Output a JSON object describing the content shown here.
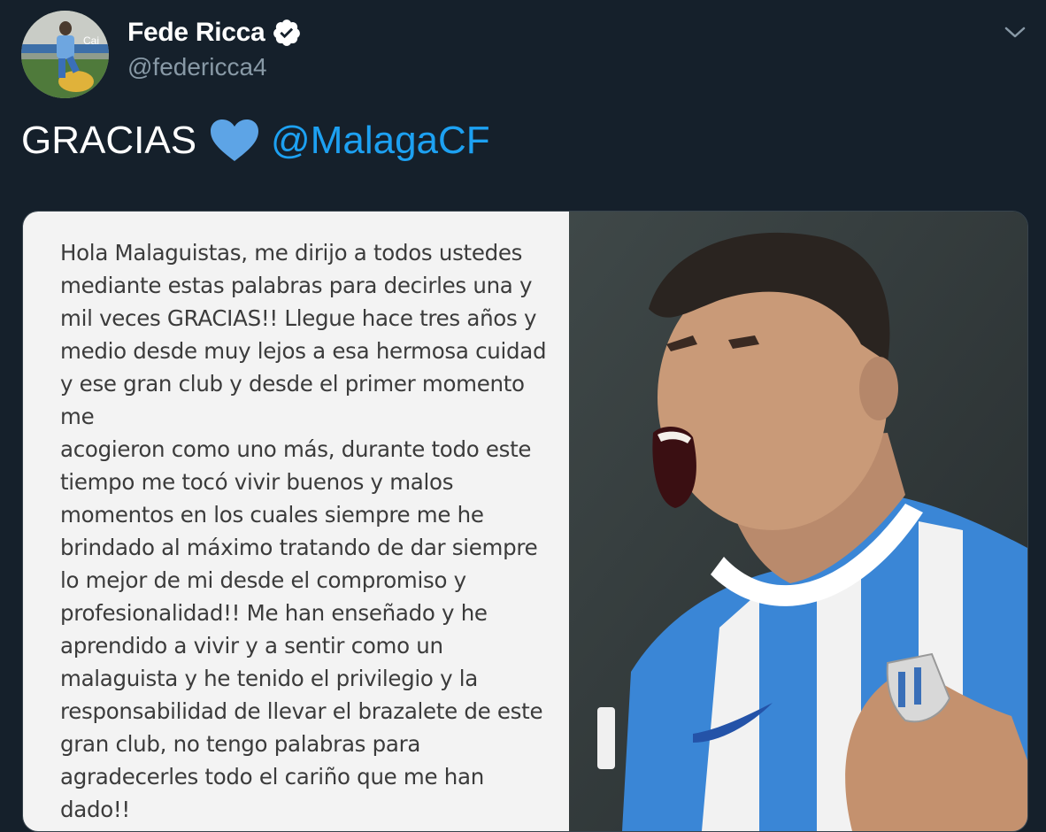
{
  "tweet": {
    "display_name": "Fede Ricca",
    "handle": "@federicca4",
    "text_prefix": "GRACIAS",
    "mention": "@MalagaCF",
    "icons": {
      "verified": "verified-badge-icon",
      "heart": "blue-heart-icon",
      "menu": "chevron-down-icon"
    },
    "colors": {
      "background": "#15202b",
      "mention": "#1da1f2",
      "heart": "#5da4e6",
      "handle": "#8899a6"
    }
  },
  "media": {
    "letter_text": "Hola Malaguistas, me dirijo a todos ustedes\nmediante estas palabras para decirles una y\nmil veces GRACIAS!! Llegue hace tres años y\nmedio desde muy lejos a esa hermosa cuidad\ny ese gran club y desde el primer momento me\nacogieron como uno más, durante todo este\ntiempo me tocó vivir buenos y malos\nmomentos en los cuales siempre me he\nbrindado al máximo tratando de dar siempre\nlo mejor de mi desde el compromiso y\nprofesionalidad!! Me han enseñado y he\naprendido a vivir y a sentir como un\nmalaguista y he tenido el privilegio y la\nresponsabilidad de llevar el brazalete de este\ngran club, no tengo palabras para\nagradecerles todo el cariño que me han dado!!\nQuiero agradecer a todos mis compañeros y"
  }
}
